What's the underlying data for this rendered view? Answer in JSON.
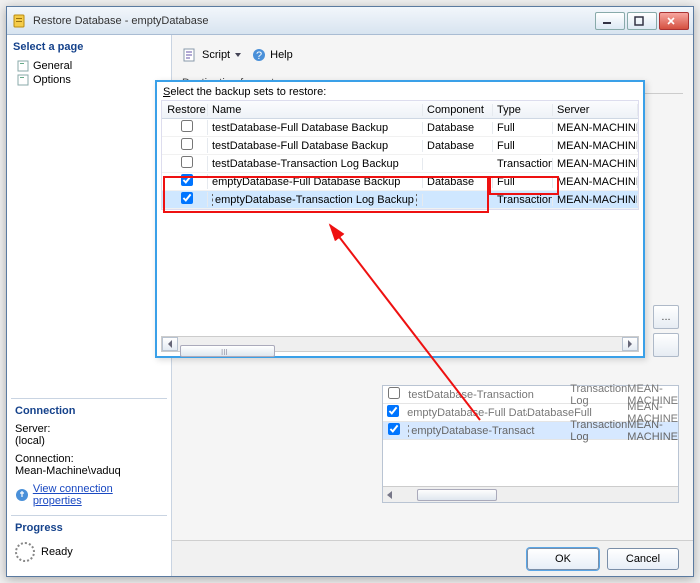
{
  "window": {
    "title": "Restore Database - emptyDatabase"
  },
  "select_page": {
    "header": "Select a page",
    "items": [
      {
        "label": "General"
      },
      {
        "label": "Options"
      }
    ]
  },
  "connection": {
    "header": "Connection",
    "server_label": "Server:",
    "server_value": "(local)",
    "conn_label": "Connection:",
    "conn_value": "Mean-Machine\\vaduq",
    "view_props": "View connection properties"
  },
  "progress": {
    "header": "Progress",
    "status": "Ready"
  },
  "toolbar": {
    "script": "Script",
    "help": "Help"
  },
  "dest_label": "Destination for restore",
  "overlay": {
    "prompt_pre": "S",
    "prompt_rest": "elect the backup sets to restore:",
    "headers": {
      "restore": "Restore",
      "name": "Name",
      "component": "Component",
      "type": "Type",
      "server": "Server"
    },
    "rows": [
      {
        "checked": false,
        "name": "testDatabase-Full Database Backup",
        "component": "Database",
        "type": "Full",
        "server": "MEAN-MACHINE"
      },
      {
        "checked": false,
        "name": "testDatabase-Full Database Backup",
        "component": "Database",
        "type": "Full",
        "server": "MEAN-MACHINE"
      },
      {
        "checked": false,
        "name": "testDatabase-Transaction Log  Backup",
        "component": "",
        "type": "Transaction Log",
        "server": "MEAN-MACHINE"
      },
      {
        "checked": true,
        "name": "emptyDatabase-Full Database Backup",
        "component": "Database",
        "type": "Full",
        "server": "MEAN-MACHINE"
      },
      {
        "checked": true,
        "name": "emptyDatabase-Transaction Log  Backup",
        "component": "",
        "type": "Transaction Log",
        "server": "MEAN-MACHINE"
      }
    ],
    "scroll_label": "III"
  },
  "bg_rows": [
    {
      "checked": false,
      "name": "testDatabase-Transaction Log  Backup",
      "component": "",
      "type": "Transaction Log",
      "server": "MEAN-MACHINE"
    },
    {
      "checked": true,
      "name": "emptyDatabase-Full Database Backup",
      "component": "Database",
      "type": "Full",
      "server": "MEAN-MACHINE"
    },
    {
      "checked": true,
      "name": "emptyDatabase-Transaction Log  Backup",
      "component": "",
      "type": "Transaction Log",
      "server": "MEAN-MACHINE"
    }
  ],
  "sidebtn_ellipsis": "...",
  "buttons": {
    "ok": "OK",
    "cancel": "Cancel"
  }
}
